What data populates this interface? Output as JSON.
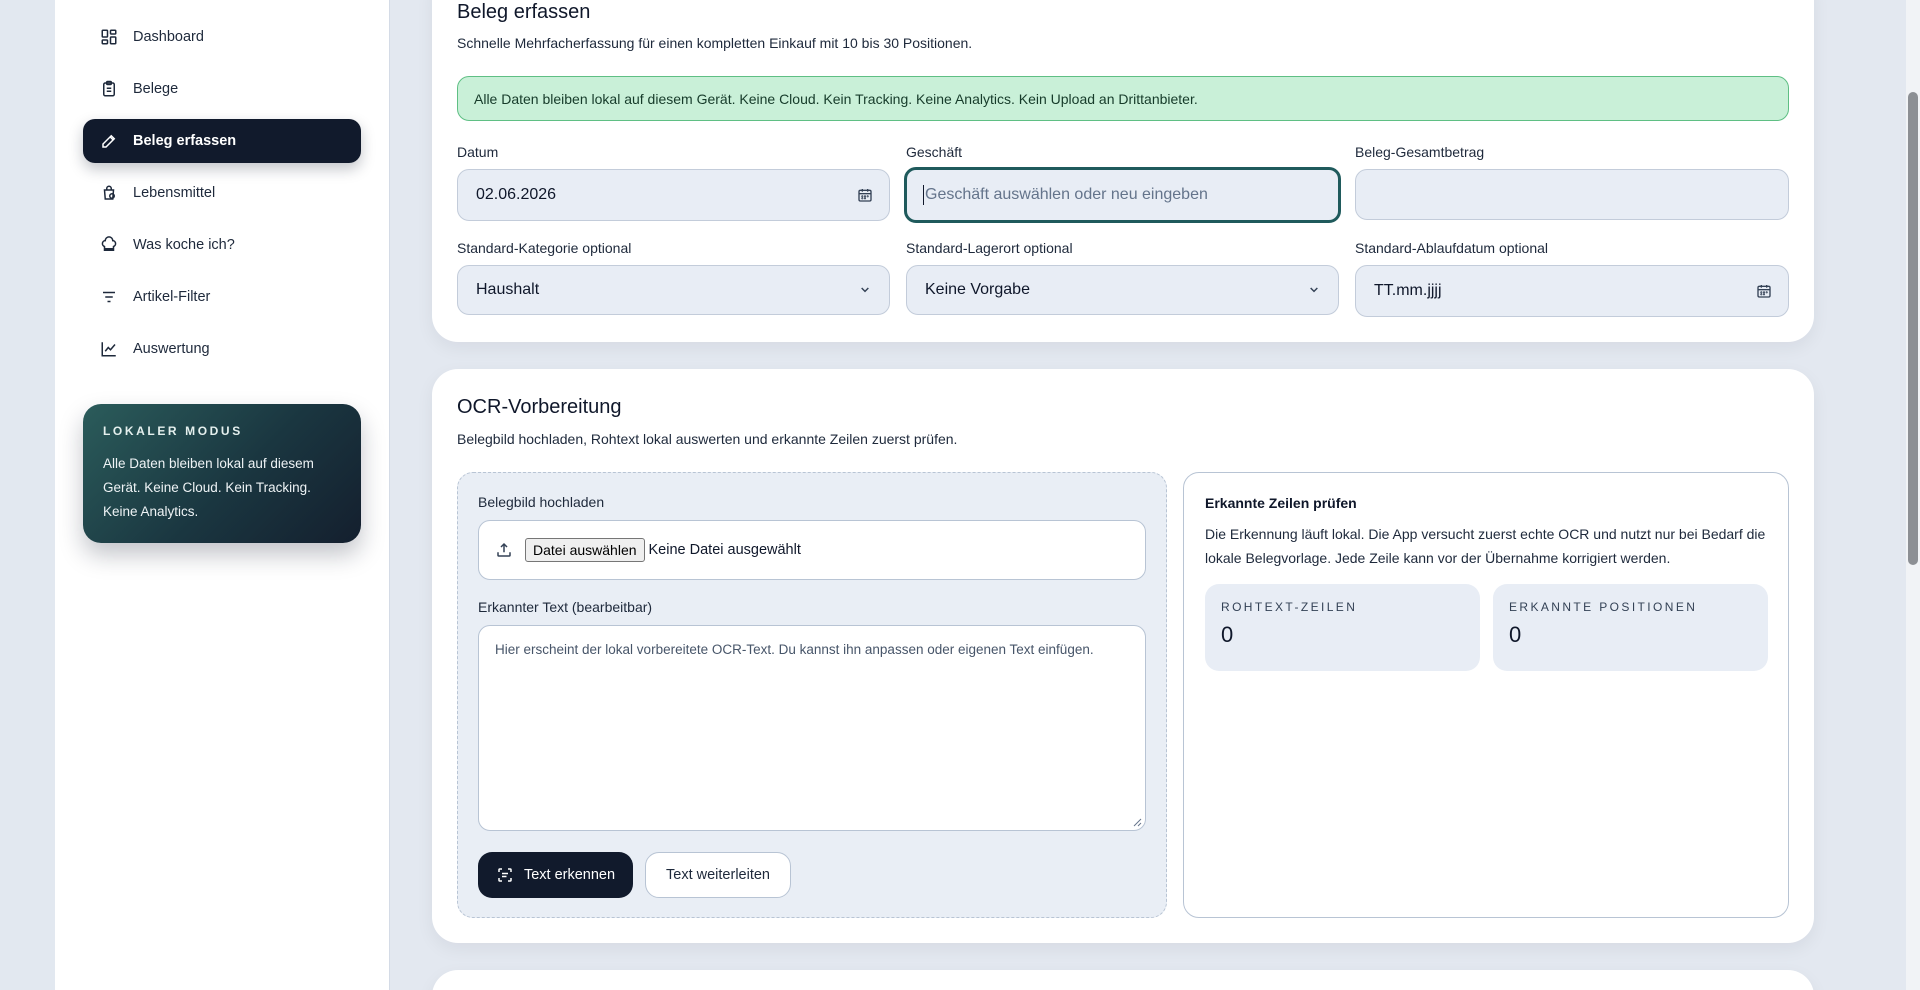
{
  "sidebar": {
    "items": [
      {
        "label": "Dashboard",
        "icon": "dashboard-icon"
      },
      {
        "label": "Belege",
        "icon": "receipt-icon"
      },
      {
        "label": "Beleg erfassen",
        "icon": "pencil-icon",
        "active": true
      },
      {
        "label": "Lebensmittel",
        "icon": "grocery-icon"
      },
      {
        "label": "Was koche ich?",
        "icon": "chef-hat-icon"
      },
      {
        "label": "Artikel-Filter",
        "icon": "filter-icon"
      },
      {
        "label": "Auswertung",
        "icon": "chart-line-icon"
      }
    ],
    "local_card": {
      "title": "LOKALER MODUS",
      "text": "Alle Daten bleiben lokal auf diesem Gerät. Keine Cloud. Kein Tracking. Keine Analytics."
    }
  },
  "capture": {
    "title": "Beleg erfassen",
    "subtitle": "Schnelle Mehrfacherfassung für einen kompletten Einkauf mit 10 bis 30 Positionen.",
    "notice": "Alle Daten bleiben lokal auf diesem Gerät. Keine Cloud. Kein Tracking. Keine Analytics. Kein Upload an Drittanbieter.",
    "date": {
      "label": "Datum",
      "value": "02.06.2026"
    },
    "store": {
      "label": "Geschäft",
      "placeholder": "Geschäft auswählen oder neu eingeben"
    },
    "total": {
      "label": "Beleg-Gesamtbetrag",
      "value": ""
    },
    "category": {
      "label": "Standard-Kategorie optional",
      "value": "Haushalt"
    },
    "location": {
      "label": "Standard-Lagerort optional",
      "value": "Keine Vorgabe"
    },
    "expiry": {
      "label": "Standard-Ablaufdatum optional",
      "value": "TT.mm.jjjj"
    }
  },
  "ocr": {
    "title": "OCR-Vorbereitung",
    "subtitle": "Belegbild hochladen, Rohtext lokal auswerten und erkannte Zeilen zuerst prüfen.",
    "upload_label": "Belegbild hochladen",
    "file_button": "Datei auswählen",
    "file_status": "Keine Datei ausgewählt",
    "text_label": "Erkannter Text (bearbeitbar)",
    "text_placeholder": "Hier erscheint der lokal vorbereitete OCR-Text. Du kannst ihn anpassen oder eigenen Text einfügen.",
    "recognize_button": "Text erkennen",
    "forward_button": "Text weiterleiten",
    "review": {
      "title": "Erkannte Zeilen prüfen",
      "text": "Die Erkennung läuft lokal. Die App versucht zuerst echte OCR und nutzt nur bei Bedarf die lokale Belegvorlage. Jede Zeile kann vor der Übernahme korrigiert werden.",
      "stats": [
        {
          "label": "ROHTEXT-ZEILEN",
          "value": "0"
        },
        {
          "label": "ERKANNTE POSITIONEN",
          "value": "0"
        }
      ]
    }
  }
}
